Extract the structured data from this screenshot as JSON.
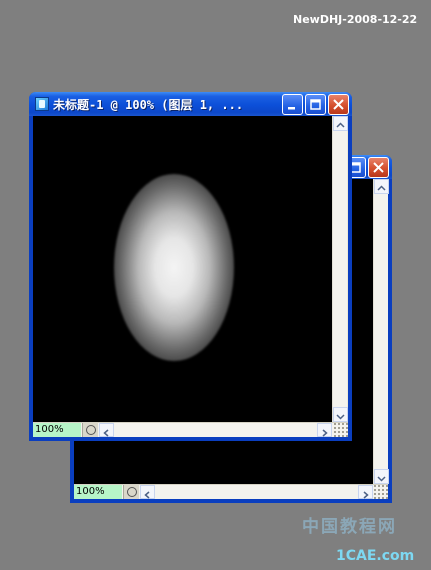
{
  "stamp": "NewDHJ-2008-12-22",
  "front_window": {
    "title": "未标题-1 @ 100% (图层 1, ...",
    "zoom": "100%"
  },
  "back_window": {
    "zoom": "100%"
  },
  "watermark": {
    "site_cn": "中国教程网",
    "url": "1CAE.com"
  },
  "icons": [
    "document-icon",
    "minimize-icon",
    "maximize-icon",
    "close-icon",
    "scroll-up-icon",
    "scroll-down-icon",
    "scroll-left-icon",
    "scroll-right-icon",
    "navigator-icon",
    "resize-grip-icon"
  ],
  "colors": {
    "desktop": "#7f7f7f",
    "titlebar": "#0c4fd8",
    "close_button": "#d5502e",
    "zoom_field": "#b7f5c8",
    "canvas": "#000000"
  }
}
